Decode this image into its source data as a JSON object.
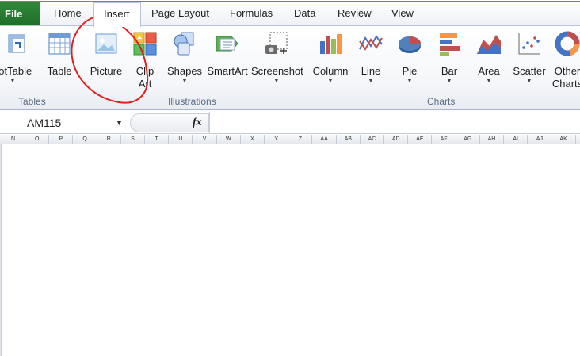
{
  "tabs": {
    "file": "File",
    "home": "Home",
    "insert": "Insert",
    "page_layout": "Page Layout",
    "formulas": "Formulas",
    "data": "Data",
    "review": "Review",
    "view": "View"
  },
  "ribbon": {
    "pivot_table": "votTable",
    "table": "Table",
    "picture": "Picture",
    "clip_art_line1": "Clip",
    "clip_art_line2": "Art",
    "shapes": "Shapes",
    "smartart": "SmartArt",
    "screenshot": "Screenshot",
    "column": "Column",
    "line": "Line",
    "pie": "Pie",
    "bar": "Bar",
    "area": "Area",
    "scatter": "Scatter",
    "other_line1": "Other",
    "other_line2": "Charts",
    "groups": {
      "tables": "Tables",
      "illustrations": "Illustrations",
      "charts": "Charts"
    }
  },
  "formula_bar": {
    "name_box": "AM115",
    "fx": "fx",
    "formula": ""
  },
  "columns": [
    "N",
    "O",
    "P",
    "Q",
    "R",
    "S",
    "T",
    "U",
    "V",
    "W",
    "X",
    "Y",
    "Z",
    "AA",
    "AB",
    "AC",
    "AD",
    "AE",
    "AF",
    "AG",
    "AH",
    "AI",
    "AJ",
    "AK"
  ],
  "colors": {
    "file_tab": "#2f8a3a",
    "annotation": "#e02020",
    "accent": "#d43b3b"
  }
}
